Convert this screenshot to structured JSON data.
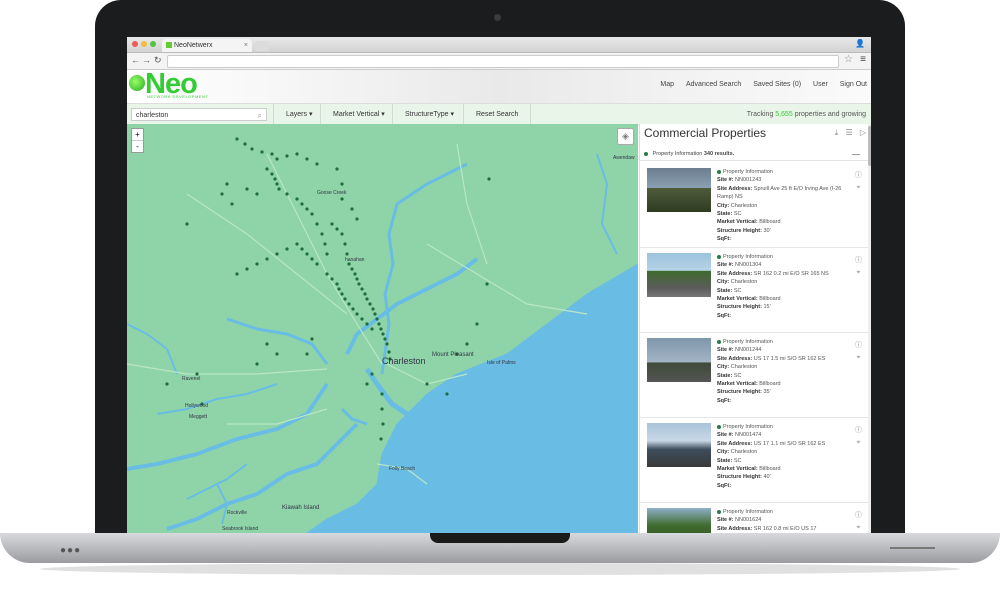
{
  "browser": {
    "tab_title": "NeoNetwerx",
    "url": ""
  },
  "app": {
    "logo_text": "Neo",
    "logo_subtitle": "NETWORK DEVELOPMENT",
    "brand_color": "#33cc33",
    "nav": [
      "Map",
      "Advanced Search",
      "Saved Sites (0)",
      "User",
      "Sign Out"
    ]
  },
  "toolbar": {
    "search_value": "charleston",
    "buttons": [
      "Layers ▾",
      "Market Vertical ▾",
      "StructureType ▾",
      "Reset Search"
    ],
    "tracking_prefix": "Tracking",
    "tracking_count": "5,655",
    "tracking_suffix": "properties and growing"
  },
  "map": {
    "zoom_in": "+",
    "zoom_out": "-",
    "land_color": "#8fd4a9",
    "water_color": "#69bde4",
    "marker_color": "#1e6e3c",
    "labels": {
      "awendaw": "Awendaw",
      "goose_creek": "Goose Creek",
      "hanahan": "hanahan",
      "charleston": "Charleston",
      "mount_pleasant": "Mount Pleasant",
      "isle_of_palms": "Isle of Palms",
      "ravenel": "Ravenel",
      "hollywood": "Hollywood",
      "meggett": "Meggett",
      "folly_beach": "Folly Beach",
      "kiawah_island": "Kiawah Island",
      "rockville": "Rockville",
      "seabrook_island": "Seabrook Island"
    }
  },
  "panel": {
    "title": "Commercial Properties",
    "result_label": "Property Information",
    "result_count": "340 results.",
    "collapse": "—",
    "field_labels": {
      "header": "Property Information",
      "site": "Site #:",
      "address": "Site Address:",
      "city": "City:",
      "state": "State:",
      "vertical": "Market Vertical:",
      "height": "Structure Height:",
      "sqft": "SqFt:"
    },
    "properties": [
      {
        "site": "NN001243",
        "address": "Spruill Ave 25 ft E/O Irving Ave (I-26 Ramp) NS",
        "city": "Charleston",
        "state": "SC",
        "vertical": "Billboard",
        "height": "30'",
        "sqft": ""
      },
      {
        "site": "NN001304",
        "address": "SR 162 0.2 mi E/O SR 165 NS",
        "city": "Charleston",
        "state": "SC",
        "vertical": "Billboard",
        "height": "15'",
        "sqft": ""
      },
      {
        "site": "NN001244",
        "address": "US 17 1.5 mi S/O SR 162 ES",
        "city": "Charleston",
        "state": "SC",
        "vertical": "Billboard",
        "height": "35'",
        "sqft": ""
      },
      {
        "site": "NN001474",
        "address": "US 17 1.1 mi S/O SR 162 ES",
        "city": "Charleston",
        "state": "SC",
        "vertical": "Billboard",
        "height": "40'",
        "sqft": ""
      },
      {
        "site": "NN001624",
        "address": "SR 162 0.8 mi E/O US 17",
        "city": "",
        "state": "",
        "vertical": "",
        "height": "",
        "sqft": ""
      }
    ]
  }
}
